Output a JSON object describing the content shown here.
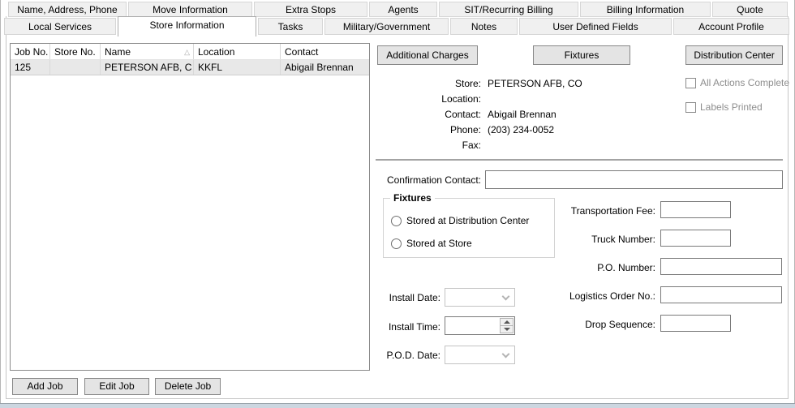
{
  "colors": {
    "selected_row_bg": "#e8e8e8",
    "disabled_text": "#8e8e8e",
    "tab_inactive_bg": "#f0f0f0"
  },
  "icons": {
    "sort_ascending": "△"
  },
  "tabs": {
    "row1": [
      {
        "label": "Name, Address, Phone"
      },
      {
        "label": "Move Information"
      },
      {
        "label": "Extra Stops"
      },
      {
        "label": "Agents"
      },
      {
        "label": "SIT/Recurring Billing"
      },
      {
        "label": "Billing Information"
      },
      {
        "label": "Quote"
      }
    ],
    "row2": [
      {
        "label": "Local Services"
      },
      {
        "label": "Store Information",
        "active": true
      },
      {
        "label": "Tasks"
      },
      {
        "label": "Military/Government"
      },
      {
        "label": "Notes"
      },
      {
        "label": "User Defined Fields"
      },
      {
        "label": "Account Profile"
      }
    ]
  },
  "job_table": {
    "columns": [
      {
        "label": "Job No."
      },
      {
        "label": "Store No."
      },
      {
        "label": "Name",
        "sort": "asc"
      },
      {
        "label": "Location"
      },
      {
        "label": "Contact"
      }
    ],
    "rows": [
      {
        "job_no": "125",
        "store_no": "",
        "name": "PETERSON AFB, C",
        "location": "KKFL",
        "contact": "Abigail Brennan"
      }
    ]
  },
  "job_actions": {
    "add_label": "Add Job",
    "edit_label": "Edit Job",
    "delete_label": "Delete Job"
  },
  "panel_buttons": {
    "additional_charges": "Additional Charges",
    "fixtures": "Fixtures",
    "distribution_center": "Distribution Center"
  },
  "store_info": {
    "store_label": "Store:",
    "store_value": "PETERSON AFB, CO",
    "location_label": "Location:",
    "location_value": "",
    "contact_label": "Contact:",
    "contact_value": "Abigail Brennan",
    "phone_label": "Phone:",
    "phone_value": "(203) 234-0052",
    "fax_label": "Fax:",
    "fax_value": ""
  },
  "checkboxes": {
    "all_actions_complete_label": "All Actions Complete",
    "labels_printed_label": "Labels Printed"
  },
  "form": {
    "confirmation_contact_label": "Confirmation Contact:",
    "confirmation_contact_value": "",
    "fixtures_group": {
      "title": "Fixtures",
      "option_distribution": "Stored at Distribution Center",
      "option_store": "Stored at Store"
    },
    "install_date_label": "Install Date:",
    "install_time_label": "Install Time:",
    "install_time_value": "",
    "pod_date_label": "P.O.D. Date:",
    "transportation_fee_label": "Transportation Fee:",
    "transportation_fee_value": "",
    "truck_number_label": "Truck Number:",
    "truck_number_value": "",
    "po_number_label": "P.O. Number:",
    "po_number_value": "",
    "logistics_order_label": "Logistics Order No.:",
    "logistics_order_value": "",
    "drop_sequence_label": "Drop Sequence:",
    "drop_sequence_value": ""
  }
}
